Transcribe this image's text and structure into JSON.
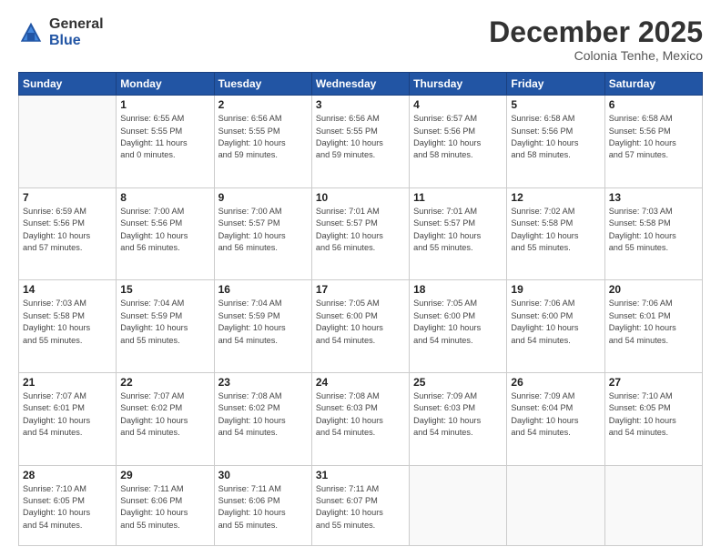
{
  "logo": {
    "general": "General",
    "blue": "Blue"
  },
  "header": {
    "month": "December 2025",
    "location": "Colonia Tenhe, Mexico"
  },
  "weekdays": [
    "Sunday",
    "Monday",
    "Tuesday",
    "Wednesday",
    "Thursday",
    "Friday",
    "Saturday"
  ],
  "weeks": [
    [
      {
        "date": "",
        "info": ""
      },
      {
        "date": "1",
        "info": "Sunrise: 6:55 AM\nSunset: 5:55 PM\nDaylight: 11 hours\nand 0 minutes."
      },
      {
        "date": "2",
        "info": "Sunrise: 6:56 AM\nSunset: 5:55 PM\nDaylight: 10 hours\nand 59 minutes."
      },
      {
        "date": "3",
        "info": "Sunrise: 6:56 AM\nSunset: 5:55 PM\nDaylight: 10 hours\nand 59 minutes."
      },
      {
        "date": "4",
        "info": "Sunrise: 6:57 AM\nSunset: 5:56 PM\nDaylight: 10 hours\nand 58 minutes."
      },
      {
        "date": "5",
        "info": "Sunrise: 6:58 AM\nSunset: 5:56 PM\nDaylight: 10 hours\nand 58 minutes."
      },
      {
        "date": "6",
        "info": "Sunrise: 6:58 AM\nSunset: 5:56 PM\nDaylight: 10 hours\nand 57 minutes."
      }
    ],
    [
      {
        "date": "7",
        "info": "Sunrise: 6:59 AM\nSunset: 5:56 PM\nDaylight: 10 hours\nand 57 minutes."
      },
      {
        "date": "8",
        "info": "Sunrise: 7:00 AM\nSunset: 5:56 PM\nDaylight: 10 hours\nand 56 minutes."
      },
      {
        "date": "9",
        "info": "Sunrise: 7:00 AM\nSunset: 5:57 PM\nDaylight: 10 hours\nand 56 minutes."
      },
      {
        "date": "10",
        "info": "Sunrise: 7:01 AM\nSunset: 5:57 PM\nDaylight: 10 hours\nand 56 minutes."
      },
      {
        "date": "11",
        "info": "Sunrise: 7:01 AM\nSunset: 5:57 PM\nDaylight: 10 hours\nand 55 minutes."
      },
      {
        "date": "12",
        "info": "Sunrise: 7:02 AM\nSunset: 5:58 PM\nDaylight: 10 hours\nand 55 minutes."
      },
      {
        "date": "13",
        "info": "Sunrise: 7:03 AM\nSunset: 5:58 PM\nDaylight: 10 hours\nand 55 minutes."
      }
    ],
    [
      {
        "date": "14",
        "info": "Sunrise: 7:03 AM\nSunset: 5:58 PM\nDaylight: 10 hours\nand 55 minutes."
      },
      {
        "date": "15",
        "info": "Sunrise: 7:04 AM\nSunset: 5:59 PM\nDaylight: 10 hours\nand 55 minutes."
      },
      {
        "date": "16",
        "info": "Sunrise: 7:04 AM\nSunset: 5:59 PM\nDaylight: 10 hours\nand 54 minutes."
      },
      {
        "date": "17",
        "info": "Sunrise: 7:05 AM\nSunset: 6:00 PM\nDaylight: 10 hours\nand 54 minutes."
      },
      {
        "date": "18",
        "info": "Sunrise: 7:05 AM\nSunset: 6:00 PM\nDaylight: 10 hours\nand 54 minutes."
      },
      {
        "date": "19",
        "info": "Sunrise: 7:06 AM\nSunset: 6:00 PM\nDaylight: 10 hours\nand 54 minutes."
      },
      {
        "date": "20",
        "info": "Sunrise: 7:06 AM\nSunset: 6:01 PM\nDaylight: 10 hours\nand 54 minutes."
      }
    ],
    [
      {
        "date": "21",
        "info": "Sunrise: 7:07 AM\nSunset: 6:01 PM\nDaylight: 10 hours\nand 54 minutes."
      },
      {
        "date": "22",
        "info": "Sunrise: 7:07 AM\nSunset: 6:02 PM\nDaylight: 10 hours\nand 54 minutes."
      },
      {
        "date": "23",
        "info": "Sunrise: 7:08 AM\nSunset: 6:02 PM\nDaylight: 10 hours\nand 54 minutes."
      },
      {
        "date": "24",
        "info": "Sunrise: 7:08 AM\nSunset: 6:03 PM\nDaylight: 10 hours\nand 54 minutes."
      },
      {
        "date": "25",
        "info": "Sunrise: 7:09 AM\nSunset: 6:03 PM\nDaylight: 10 hours\nand 54 minutes."
      },
      {
        "date": "26",
        "info": "Sunrise: 7:09 AM\nSunset: 6:04 PM\nDaylight: 10 hours\nand 54 minutes."
      },
      {
        "date": "27",
        "info": "Sunrise: 7:10 AM\nSunset: 6:05 PM\nDaylight: 10 hours\nand 54 minutes."
      }
    ],
    [
      {
        "date": "28",
        "info": "Sunrise: 7:10 AM\nSunset: 6:05 PM\nDaylight: 10 hours\nand 54 minutes."
      },
      {
        "date": "29",
        "info": "Sunrise: 7:11 AM\nSunset: 6:06 PM\nDaylight: 10 hours\nand 55 minutes."
      },
      {
        "date": "30",
        "info": "Sunrise: 7:11 AM\nSunset: 6:06 PM\nDaylight: 10 hours\nand 55 minutes."
      },
      {
        "date": "31",
        "info": "Sunrise: 7:11 AM\nSunset: 6:07 PM\nDaylight: 10 hours\nand 55 minutes."
      },
      {
        "date": "",
        "info": ""
      },
      {
        "date": "",
        "info": ""
      },
      {
        "date": "",
        "info": ""
      }
    ]
  ]
}
